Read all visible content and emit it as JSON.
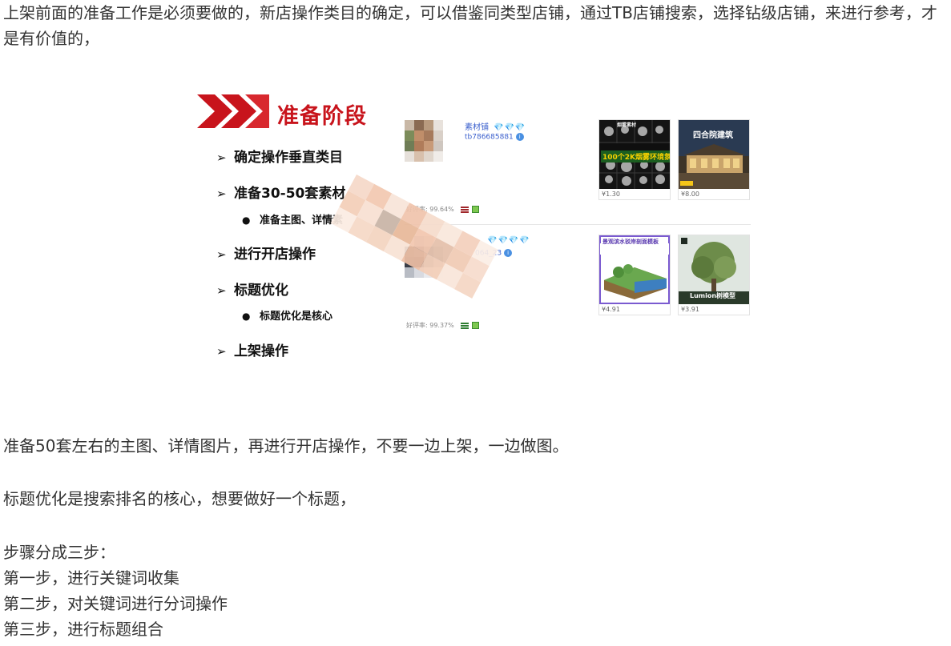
{
  "article": {
    "intro": "上架前面的准备工作是必须要做的，新店操作类目的确定，可以借鉴同类型店铺，通过TB店铺搜索，选择钻级店铺，来进行参考，才是有价值的，",
    "prep_note": "准备50套左右的主图、详情图片，再进行开店操作，不要一边上架，一边做图。",
    "title_note": "标题优化是搜索排名的核心，想要做好一个标题，",
    "steps_intro": "步骤分成三步：",
    "steps": [
      "第一步，进行关键词收集",
      "第二步，对关键词进行分词操作",
      "第三步，进行标题组合"
    ]
  },
  "figure": {
    "banner_title": "准备阶段",
    "outline": [
      {
        "text": "确定操作垂直类目",
        "sub": []
      },
      {
        "text": "准备30-50套素材",
        "sub": [
          "准备主图、详情素"
        ]
      },
      {
        "text": "进行开店操作",
        "sub": []
      },
      {
        "text": "标题优化",
        "sub": [
          "标题优化是核心"
        ]
      },
      {
        "text": "上架操作",
        "sub": []
      }
    ],
    "shops": [
      {
        "name": "素材铺",
        "diamonds": "💎💎💎",
        "id": "tb786685881",
        "rating": "好评率: 99.64%",
        "products": [
          {
            "price": "¥1.30",
            "label_top": "烟雾素材",
            "label_main": "100个2K烟雾环境氛围"
          },
          {
            "price": "¥8.00",
            "label_top": "四合院建筑",
            "label_main": ""
          }
        ]
      },
      {
        "name": "",
        "diamonds": "💎💎💎💎",
        "id": "064_23",
        "rating": "好评率: 99.37%",
        "products": [
          {
            "price": "¥4.91",
            "label_top": "景观滨水驳岸剖面模板",
            "label_main": ""
          },
          {
            "price": "¥3.91",
            "label_top": "",
            "label_main": "Lumion树模型"
          }
        ]
      }
    ]
  },
  "colors": {
    "banner_red": "#c8141c",
    "text": "#333333",
    "link_blue": "#3a5fcd"
  }
}
